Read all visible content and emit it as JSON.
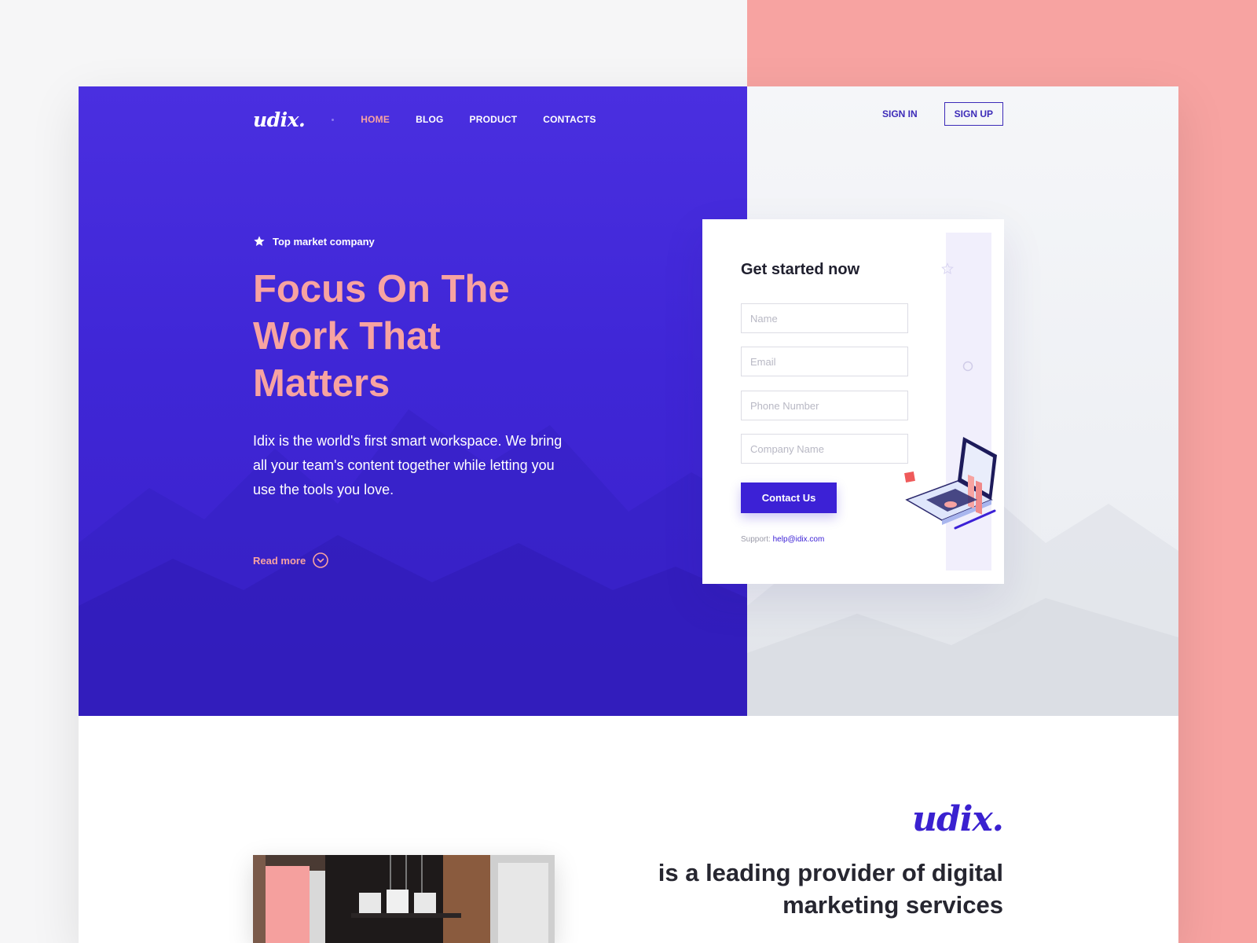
{
  "nav": {
    "logo": "udix.",
    "links": [
      "HOME",
      "BLOG",
      "PRODUCT",
      "CONTACTS"
    ],
    "active": "HOME",
    "signin": "SIGN IN",
    "signup": "SIGN UP"
  },
  "hero": {
    "badge": "Top market company",
    "headline": "Focus On The Work That Matters",
    "description": "Idix is the world's first smart workspace. We bring all your team's content together while letting you use the tools you love.",
    "read_more": "Read more"
  },
  "form": {
    "title": "Get started now",
    "fields": {
      "name": "Name",
      "email": "Email",
      "phone": "Phone Number",
      "company": "Company Name"
    },
    "button": "Contact Us",
    "support_label": "Support:",
    "support_email": "help@idix.com"
  },
  "about": {
    "logo": "udix.",
    "tagline": "is a leading provider of digital marketing services"
  },
  "colors": {
    "primary": "#3c21d6",
    "accent": "#f7a3a1",
    "dark": "#262630"
  },
  "icons": [
    "star-icon",
    "chevron-down-circle-icon",
    "laptop-illustration"
  ]
}
